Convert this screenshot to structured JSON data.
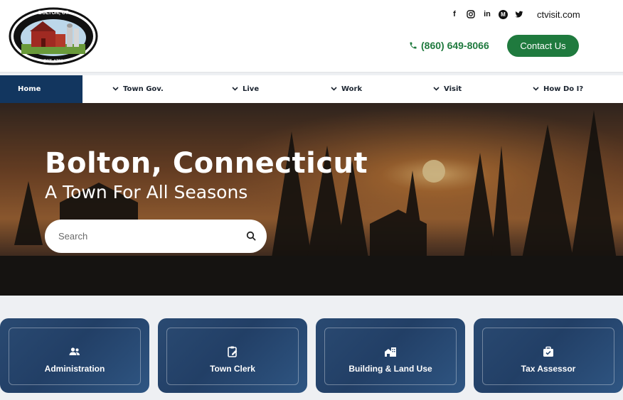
{
  "header": {
    "logo": {
      "top_text": "BOLTON, CT",
      "bottom_text": "EST. 1720"
    },
    "social": [
      {
        "name": "facebook-icon",
        "glyph": "f"
      },
      {
        "name": "instagram-icon",
        "glyph": "◎"
      },
      {
        "name": "linkedin-icon",
        "glyph": "in"
      },
      {
        "name": "medium-icon",
        "glyph": "M"
      },
      {
        "name": "twitter-icon",
        "glyph": "🐦"
      }
    ],
    "site_link": "ctvisit.com",
    "phone": "(860) 649-8066",
    "contact_label": "Contact Us",
    "accent_color": "#1f7a3e"
  },
  "nav": {
    "items": [
      {
        "label": "Home",
        "active": true
      },
      {
        "label": "Town Gov."
      },
      {
        "label": "Live"
      },
      {
        "label": "Work"
      },
      {
        "label": "Visit"
      },
      {
        "label": "How Do I?"
      }
    ],
    "active_color": "#12365f"
  },
  "hero": {
    "title": "Bolton, Connecticut",
    "subtitle": "A Town For All Seasons",
    "search_placeholder": "Search"
  },
  "cards": [
    {
      "label": "Administration",
      "icon": "people-icon"
    },
    {
      "label": "Town Clerk",
      "icon": "clipboard-icon"
    },
    {
      "label": "Building & Land Use",
      "icon": "building-icon"
    },
    {
      "label": "Tax Assessor",
      "icon": "briefcase-icon"
    }
  ]
}
